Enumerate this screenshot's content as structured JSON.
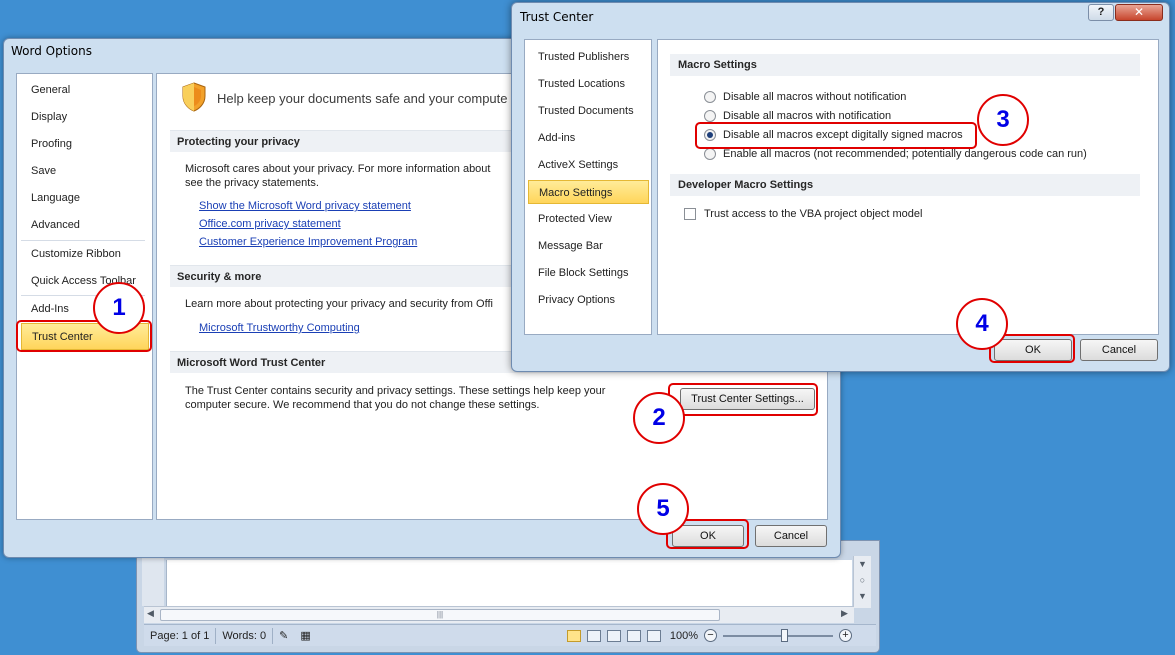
{
  "word_window": {
    "status": {
      "page": "Page: 1 of 1",
      "words": "Words: 0",
      "zoom": "100%",
      "zoom_minus": "−",
      "zoom_plus": "+"
    },
    "scroll_grip": "|||",
    "icons": [
      "proofing-icon",
      "macro-record-icon",
      "print-layout-icon",
      "full-screen-reading-icon",
      "web-layout-icon",
      "outline-icon",
      "draft-icon"
    ]
  },
  "word_options": {
    "title": "Word Options",
    "nav": [
      "General",
      "Display",
      "Proofing",
      "Save",
      "Language",
      "Advanced",
      "Customize Ribbon",
      "Quick Access Toolbar",
      "Add-Ins",
      "Trust Center"
    ],
    "active_nav": "Trust Center",
    "header": "Help keep your documents safe and your compute",
    "privacy": {
      "heading": "Protecting your privacy",
      "text_line1": "Microsoft cares about your privacy. For more information about",
      "text_line2": "see the privacy statements.",
      "links": [
        "Show the Microsoft Word privacy statement",
        "Office.com privacy statement",
        "Customer Experience Improvement Program"
      ]
    },
    "security": {
      "heading": "Security & more",
      "text": "Learn more about protecting your privacy and security from Offi",
      "link": "Microsoft Trustworthy Computing"
    },
    "trust_center": {
      "heading": "Microsoft Word Trust Center",
      "text_line1": "The Trust Center contains security and privacy settings. These settings help keep your",
      "text_line2": "computer secure. We recommend that you do not change these settings.",
      "settings_button": "Trust Center Settings..."
    },
    "ok": "OK",
    "cancel": "Cancel"
  },
  "trust_center_dialog": {
    "title": "Trust Center",
    "help": "?",
    "close": "✕",
    "nav": [
      "Trusted Publishers",
      "Trusted Locations",
      "Trusted Documents",
      "Add-ins",
      "ActiveX Settings",
      "Macro Settings",
      "Protected View",
      "Message Bar",
      "File Block Settings",
      "Privacy Options"
    ],
    "active_nav": "Macro Settings",
    "macro_heading": "Macro Settings",
    "macro_options": [
      "Disable all macros without notification",
      "Disable all macros with notification",
      "Disable all macros except digitally signed macros",
      "Enable all macros (not recommended; potentially dangerous code can run)"
    ],
    "selected_option": "Disable all macros except digitally signed macros",
    "developer_heading": "Developer Macro Settings",
    "vba_checkbox": "Trust access to the VBA project object model",
    "vba_checked": false,
    "ok": "OK",
    "cancel": "Cancel"
  },
  "callouts": [
    "1",
    "2",
    "3",
    "4",
    "5"
  ],
  "colors": {
    "desktop": "#3f8fd2",
    "callout_border": "#e00000",
    "callout_text": "#0000e6",
    "active_nav": "#ffd55b",
    "link": "#1a3fb5"
  }
}
